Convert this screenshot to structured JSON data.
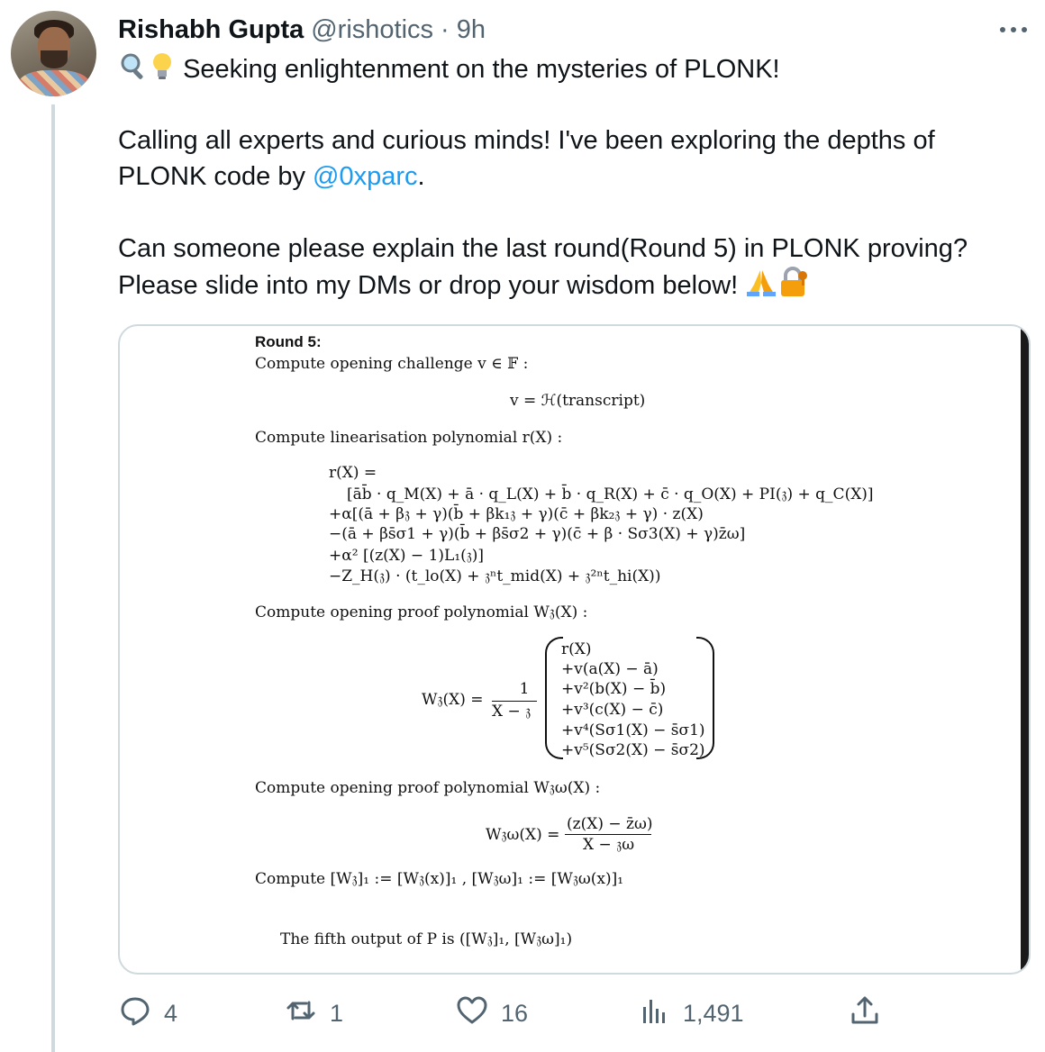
{
  "tweet": {
    "author_name": "Rishabh Gupta",
    "handle": "@rishotics",
    "separator": "·",
    "time": "9h",
    "line1": "Seeking enlightenment on the mysteries of PLONK!",
    "line2a": "Calling all experts and curious minds! I've been exploring the depths of",
    "line2b": "PLONK code by ",
    "mention": "@0xparc",
    "line2c": ".",
    "line3a": "Can someone please explain the last round(Round 5) in PLONK proving?",
    "line3b": "Please slide into my DMs or drop your wisdom below!",
    "emojis_start": [
      "magnifying-glass",
      "light-bulb"
    ],
    "emojis_end": [
      "folded-hands",
      "lock-with-key"
    ]
  },
  "image": {
    "round_title": "Round 5:",
    "step1": "Compute opening challenge v ∈ 𝔽 :",
    "eq1": "v = ℋ(transcript)",
    "step2": "Compute linearisation polynomial r(X) :",
    "r0": "r(X) =",
    "r1": "[āb̄ · q_M(X) + ā · q_L(X) + b̄ · q_R(X) + c̄ · q_O(X) + PI(𝔷) + q_C(X)]",
    "r2": "+α[(ā + β𝔷 + γ)(b̄ + βk₁𝔷 + γ)(c̄ + βk₂𝔷 + γ) · z(X)",
    "r3": "−(ā + βs̄σ1 + γ)(b̄ + βs̄σ2 + γ)(c̄ + β · Sσ3(X) + γ)z̄ω]",
    "r4": "+α² [(z(X) − 1)L₁(𝔷)]",
    "r5": "−Z_H(𝔷) · (t_lo(X) + 𝔷ⁿt_mid(X) + 𝔷²ⁿt_hi(X))",
    "step3": "Compute opening proof polynomial W𝔷(X) :",
    "w_lhs": "W𝔷(X) =",
    "w_num": "1",
    "w_den": "X − 𝔷",
    "w_rows": [
      "r(X)",
      "+v(a(X) − ā)",
      "+v²(b(X) − b̄)",
      "+v³(c(X) − c̄)",
      "+v⁴(Sσ1(X) − s̄σ1)",
      "+v⁵(Sσ2(X) − s̄σ2)"
    ],
    "step4": "Compute opening proof polynomial W𝔷ω(X) :",
    "ww_lhs": "W𝔷ω(X) =",
    "ww_num": "(z(X) − z̄ω)",
    "ww_den": "X − 𝔷ω",
    "step5": "Compute [W𝔷]₁ := [W𝔷(x)]₁ , [W𝔷ω]₁ := [W𝔷ω(x)]₁",
    "output": "The fifth output of P is ([W𝔷]₁, [W𝔷ω]₁)"
  },
  "actions": {
    "replies": "4",
    "retweets": "1",
    "likes": "16",
    "views": "1,491"
  },
  "colors": {
    "link": "#1d9bf0",
    "secondary": "#536471",
    "border": "#cfd9de"
  }
}
